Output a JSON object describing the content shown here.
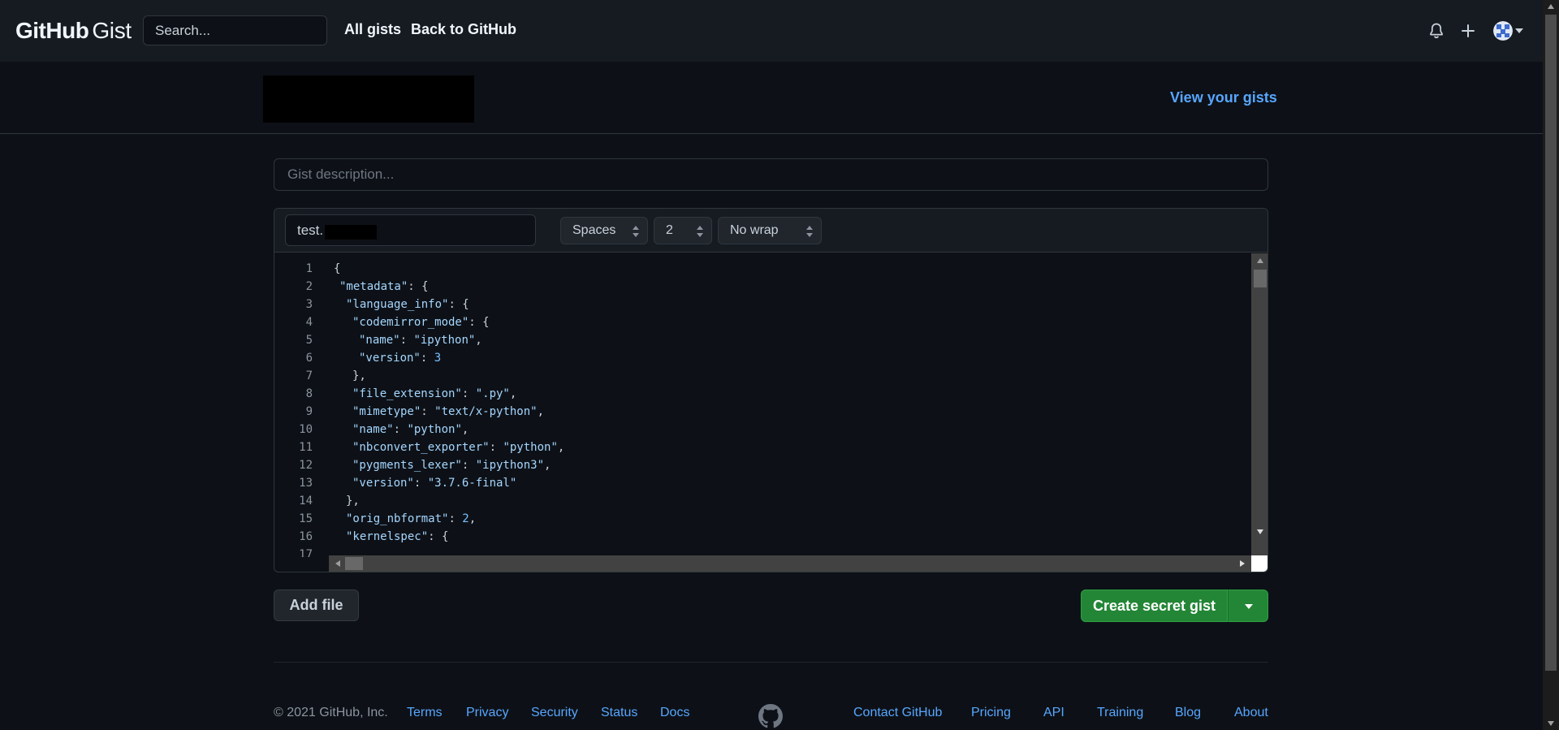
{
  "header": {
    "logo_primary": "GitHub",
    "logo_secondary": "Gist",
    "search_placeholder": "Search...",
    "nav": [
      {
        "label": "All gists"
      },
      {
        "label": "Back to GitHub"
      }
    ]
  },
  "subheader": {
    "view_gists": "View your gists"
  },
  "form": {
    "description_placeholder": "Gist description...",
    "filename_value": "test.",
    "indent_mode": "Spaces",
    "indent_size": "2",
    "wrap_mode": "No wrap"
  },
  "code": {
    "lines": [
      {
        "n": "1"
      },
      {
        "n": "2"
      },
      {
        "n": "3"
      },
      {
        "n": "4"
      },
      {
        "n": "5"
      },
      {
        "n": "6"
      },
      {
        "n": "7"
      },
      {
        "n": "8"
      },
      {
        "n": "9"
      },
      {
        "n": "10"
      },
      {
        "n": "11"
      },
      {
        "n": "12"
      },
      {
        "n": "13"
      },
      {
        "n": "14"
      },
      {
        "n": "15"
      },
      {
        "n": "16"
      },
      {
        "n": "17"
      }
    ],
    "text": {
      "l1": "{",
      "l2_key": "\"metadata\"",
      "l2_rest": ": {",
      "l3_key": "\"language_info\"",
      "l3_rest": ": {",
      "l4_key": "\"codemirror_mode\"",
      "l4_rest": ": {",
      "l5_key": "\"name\"",
      "l5_sep": ": ",
      "l5_val": "\"ipython\"",
      "l5_end": ",",
      "l6_key": "\"version\"",
      "l6_sep": ": ",
      "l6_val": "3",
      "l7": "},",
      "l8_key": "\"file_extension\"",
      "l8_sep": ": ",
      "l8_val": "\".py\"",
      "l8_end": ",",
      "l9_key": "\"mimetype\"",
      "l9_sep": ": ",
      "l9_val": "\"text/x-python\"",
      "l9_end": ",",
      "l10_key": "\"name\"",
      "l10_sep": ": ",
      "l10_val": "\"python\"",
      "l10_end": ",",
      "l11_key": "\"nbconvert_exporter\"",
      "l11_sep": ": ",
      "l11_val": "\"python\"",
      "l11_end": ",",
      "l12_key": "\"pygments_lexer\"",
      "l12_sep": ": ",
      "l12_val": "\"ipython3\"",
      "l12_end": ",",
      "l13_key": "\"version\"",
      "l13_sep": ": ",
      "l13_val": "\"3.7.6-final\"",
      "l14": "},",
      "l15_key": "\"orig_nbformat\"",
      "l15_sep": ": ",
      "l15_val": "2",
      "l15_end": ",",
      "l16_key": "\"kernelspec\"",
      "l16_rest": ": {"
    }
  },
  "actions": {
    "add_file": "Add file",
    "create": "Create secret gist"
  },
  "footer": {
    "copyright": "© 2021 GitHub, Inc.",
    "left_links": [
      "Terms",
      "Privacy",
      "Security",
      "Status",
      "Docs"
    ],
    "right_links": [
      "Contact GitHub",
      "Pricing",
      "API",
      "Training",
      "Blog",
      "About"
    ]
  },
  "icons": {
    "bell": "bell-icon",
    "plus": "plus-icon",
    "avatar": "avatar",
    "footer_mark": "github-mark-icon"
  },
  "colors": {
    "background": "#0d1117",
    "header": "#161b22",
    "link": "#58a6ff",
    "primary_button": "#238636",
    "string": "#a5d6ff",
    "number": "#79c0ff"
  }
}
